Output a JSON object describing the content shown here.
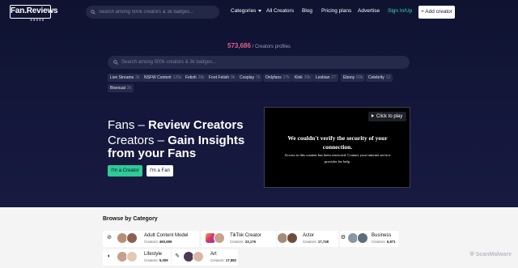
{
  "nav": {
    "logo": "Fan.Reviews",
    "logo_dots": "●●●●●",
    "search_placeholder": "Search among 500k creators & 3k badges...",
    "links": [
      "Categories",
      "All Creators",
      "Blog",
      "Pricing plans",
      "Advertise"
    ],
    "sign_in": "Sign In/Up",
    "add_creator": "+ Add creator"
  },
  "counter": {
    "value": "573,686",
    "label": "/ Creators profiles"
  },
  "search": {
    "placeholder": "Search among 500k creators & 3k badges..."
  },
  "tags": [
    {
      "label": "Live Streams",
      "count": "3k"
    },
    {
      "label": "NSFW Content",
      "count": "125k"
    },
    {
      "label": "Fetish",
      "count": "28k"
    },
    {
      "label": "Foot Fetish",
      "count": "9k"
    },
    {
      "label": "Cosplay",
      "count": "7k"
    },
    {
      "label": "Onlyfans",
      "count": "27k"
    },
    {
      "label": "Kink",
      "count": "30k"
    },
    {
      "label": "Lesbian",
      "count": "27"
    },
    {
      "label": "Ebony",
      "count": "69k"
    },
    {
      "label": "Celebrity",
      "count": "12"
    },
    {
      "label": "Bisexual",
      "count": "2k"
    }
  ],
  "hero": {
    "line1_prefix": "Fans – ",
    "line1_strong": "Review Creators",
    "line2_prefix": "Creators – ",
    "line2_strong": "Gain Insights from your Fans",
    "btn_creator": "I'm a Creator",
    "btn_fan": "I'm a Fan"
  },
  "video": {
    "play_label": "Click to play",
    "title": "We couldn't verify the security of your connection.",
    "text": "Access to this content has been restricted. Contact your internet service provider for help."
  },
  "browse": {
    "title": "Browse by Category",
    "categories": [
      {
        "name": "Adult Content Model",
        "count_label": "Creators:",
        "count": "460,696",
        "icon": "circle-icon"
      },
      {
        "name": "TikTok Creator",
        "count_label": "Creators:",
        "count": "23,176",
        "icon": "tiktok-icon"
      },
      {
        "name": "Actor",
        "count_label": "Creators:",
        "count": "17,748",
        "icon": "actor-icon"
      },
      {
        "name": "Business",
        "count_label": "Creators:",
        "count": "6,871",
        "icon": "briefcase-icon"
      },
      {
        "name": "Lifestyle",
        "count_label": "Creators:",
        "count": "5,009",
        "icon": "lifestyle-icon"
      },
      {
        "name": "Art",
        "count_label": "Creators:",
        "count": "17,882",
        "icon": "brush-icon"
      }
    ]
  },
  "watermark": "ScanMalware",
  "colors": {
    "hero_bg": "#14173b",
    "accent_green": "#2fcb96",
    "counter_pink": "#e0608a"
  }
}
